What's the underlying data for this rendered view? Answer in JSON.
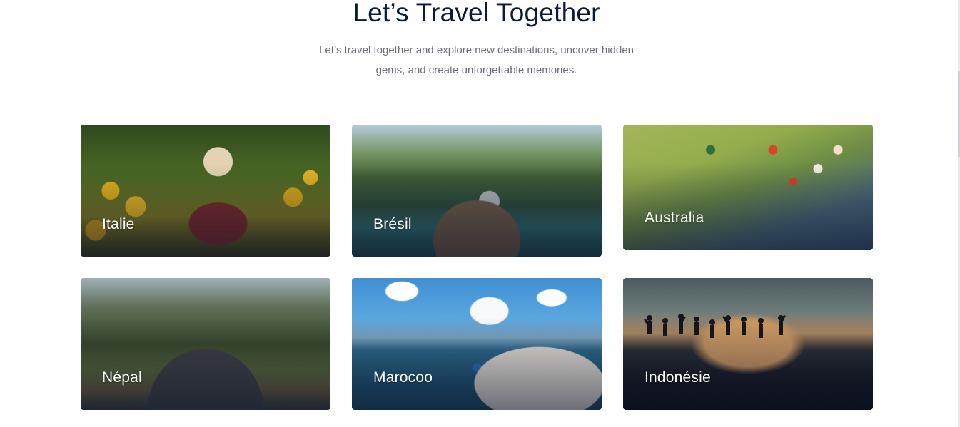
{
  "section": {
    "title": "Let’s Travel Together",
    "subtitle_line1": "Let’s travel together and explore new destinations, uncover hidden",
    "subtitle_line2": "gems, and create unforgettable memories."
  },
  "destinations": [
    {
      "name": "Italie"
    },
    {
      "name": "Brésil"
    },
    {
      "name": "Australia"
    },
    {
      "name": "Népal"
    },
    {
      "name": "Marocoo"
    },
    {
      "name": "Indonésie"
    }
  ],
  "colors": {
    "heading": "#0b1a3a",
    "subtitle": "#6b6f7c",
    "card_label": "#ffffff",
    "background": "#ffffff"
  }
}
